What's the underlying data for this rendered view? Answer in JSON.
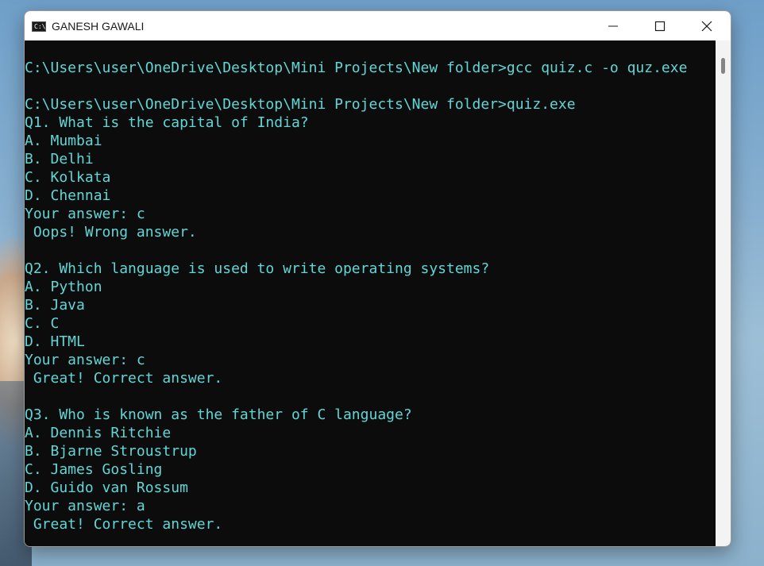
{
  "window": {
    "title": "GANESH GAWALI",
    "icon": "command-prompt-icon",
    "icon_text": "C:\\."
  },
  "controls": [
    "minimize-icon",
    "maximize-icon",
    "close-icon"
  ],
  "colors": {
    "console_bg": "#0c0c0c",
    "console_text": "#61d6d6",
    "titlebar_bg": "#ffffff"
  },
  "console": {
    "lines": [
      "C:\\Users\\user\\OneDrive\\Desktop\\Mini Projects\\New folder>gcc quiz.c -o quz.exe",
      "",
      "C:\\Users\\user\\OneDrive\\Desktop\\Mini Projects\\New folder>quiz.exe",
      "Q1. What is the capital of India?",
      "A. Mumbai",
      "B. Delhi",
      "C. Kolkata",
      "D. Chennai",
      "Your answer: c",
      " Oops! Wrong answer.",
      "",
      "Q2. Which language is used to write operating systems?",
      "A. Python",
      "B. Java",
      "C. C",
      "D. HTML",
      "Your answer: c",
      " Great! Correct answer.",
      "",
      "Q3. Who is known as the father of C language?",
      "A. Dennis Ritchie",
      "B. Bjarne Stroustrup",
      "C. James Gosling",
      "D. Guido van Rossum",
      "Your answer: a",
      " Great! Correct answer."
    ]
  }
}
